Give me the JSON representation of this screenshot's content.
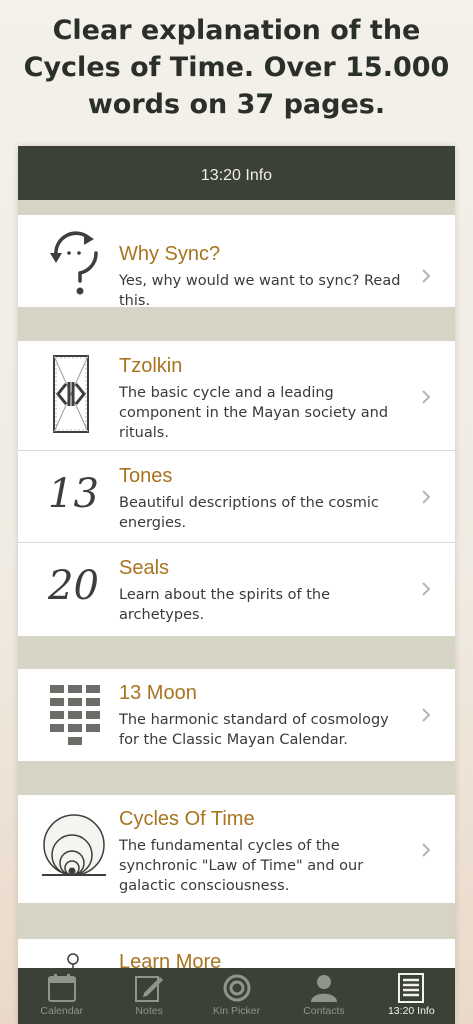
{
  "headline": "Clear explanation of the\nCycles of Time. Over 15.000\nwords on 37 pages.",
  "navbar": {
    "title": "13:20 Info"
  },
  "rows": [
    {
      "title": "Why Sync?",
      "description": "Yes, why would we want to sync? Read this.",
      "icon": "sync-question-icon"
    },
    {
      "title": "Tzolkin",
      "description": "The basic cycle and a leading component in the Mayan society and rituals.",
      "icon": "tzolkin-glyph-icon"
    },
    {
      "title": "Tones",
      "description": "Beautiful descriptions of the cosmic energies.",
      "icon_text": "13"
    },
    {
      "title": "Seals",
      "description": "Learn about the spirits of the archetypes.",
      "icon_text": "20"
    },
    {
      "title": "13 Moon",
      "description": "The harmonic standard of cosmology for the Classic Mayan Calendar.",
      "icon": "calendar-grid-icon"
    },
    {
      "title": "Cycles Of Time",
      "description": "The fundamental cycles of the synchronic \"Law of Time\" and our galactic consciousness.",
      "icon": "nested-circles-icon"
    },
    {
      "title": "Learn More",
      "icon": "pin-icon"
    }
  ],
  "tabs": [
    {
      "label": "Calendar",
      "icon": "calendar-icon",
      "active": false
    },
    {
      "label": "Notes",
      "icon": "notes-icon",
      "active": false
    },
    {
      "label": "Kin Picker",
      "icon": "kin-picker-icon",
      "active": false
    },
    {
      "label": "Contacts",
      "icon": "contacts-icon",
      "active": false
    },
    {
      "label": "13:20 Info",
      "icon": "info-list-icon",
      "active": true
    }
  ],
  "colors": {
    "bar": "#3b4137",
    "accent": "#a8741f",
    "separator": "#d6d4c4"
  }
}
